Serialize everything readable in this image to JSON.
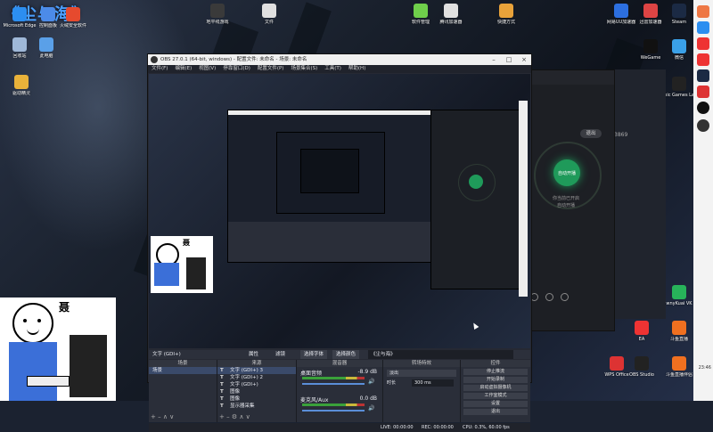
{
  "overlay_title": "《尘与海》",
  "desktop_icons": [
    {
      "label": "Microsoft Edge",
      "color": "#2c8ef0"
    },
    {
      "label": "控制面板",
      "color": "#4c8be8"
    },
    {
      "label": "火绒安全软件",
      "color": "#e64a2e"
    },
    {
      "label": "回收站",
      "color": "#9fb8d8"
    },
    {
      "label": "此电脑",
      "color": "#5aa0e8"
    },
    {
      "label": "驱动精灵",
      "color": "#e9b23a"
    },
    {
      "label": "地平线游戏",
      "color": "#3a3a3a"
    },
    {
      "label": "文件",
      "color": "#e0e0e0"
    },
    {
      "label": "腾讯加速器",
      "color": "#e0e0e0"
    },
    {
      "label": "软件管理",
      "color": "#6fcf4b"
    },
    {
      "label": "快捷方式",
      "color": "#e8a23a"
    },
    {
      "label": "网易UU加速器",
      "color": "#2c6fe0"
    },
    {
      "label": "迅雷加速器",
      "color": "#d44"
    },
    {
      "label": "Steam",
      "color": "#1b2a44"
    },
    {
      "label": "WeGame",
      "color": "#111"
    },
    {
      "label": "微信",
      "color": "#3aa0e8"
    },
    {
      "label": "Epic Games Launcher",
      "color": "#222"
    },
    {
      "label": "wnyKuai VK",
      "color": "#27b35a"
    },
    {
      "label": "EA",
      "color": "#e33"
    },
    {
      "label": "斗鱼直播",
      "color": "#f07020"
    },
    {
      "label": "WPS Office",
      "color": "#d33"
    },
    {
      "label": "OBS Studio",
      "color": "#222"
    },
    {
      "label": "斗鱼直播伴侣",
      "color": "#f07020"
    }
  ],
  "obs": {
    "title": "OBS 27.0.1 (64-bit, windows) - 配置文件: 未命名 - 场景: 未命名",
    "menu": [
      "文件(F)",
      "编辑(E)",
      "视图(V)",
      "停靠窗口(D)",
      "配置文件(P)",
      "场景集合(S)",
      "工具(T)",
      "帮助(H)"
    ],
    "source_bar": {
      "name": "文字 (GDI+)",
      "props": "属性",
      "filters": "滤镜",
      "font": "选择字体",
      "color": "选择颜色",
      "text": "《尘与海》"
    },
    "dock_titles": {
      "scenes": "场景",
      "sources": "来源",
      "mixer": "混音器",
      "transitions": "转场特效",
      "controls": "控件"
    },
    "scenes": [
      "场景"
    ],
    "sources": [
      "文字 (GDI+) 3",
      "文字 (GDI+) 2",
      "文字 (GDI+)",
      "图像",
      "图像",
      "显示器采集"
    ],
    "mixer": [
      {
        "name": "桌面音频",
        "db": "-8.9 dB"
      },
      {
        "name": "麦克风/Aux",
        "db": "0.0 dB"
      }
    ],
    "transition": {
      "value": "淡出",
      "duration_label": "时长",
      "duration": "300 ms"
    },
    "controls": [
      "停止推流",
      "开始录制",
      "启动虚拟摄像机",
      "工作室模式",
      "设置",
      "退出"
    ],
    "status": {
      "live": "LIVE: 00:00:00",
      "rec": "REC: 00:00:00",
      "cpu": "CPU: 0.3%, 60.00 fps"
    }
  },
  "right_app": {
    "exit": "退出",
    "center": "自动开播",
    "hint1": "你当前已开启",
    "hint2": "自动开播",
    "count": "3869"
  },
  "meme_char": "聂",
  "clock": "23:46"
}
